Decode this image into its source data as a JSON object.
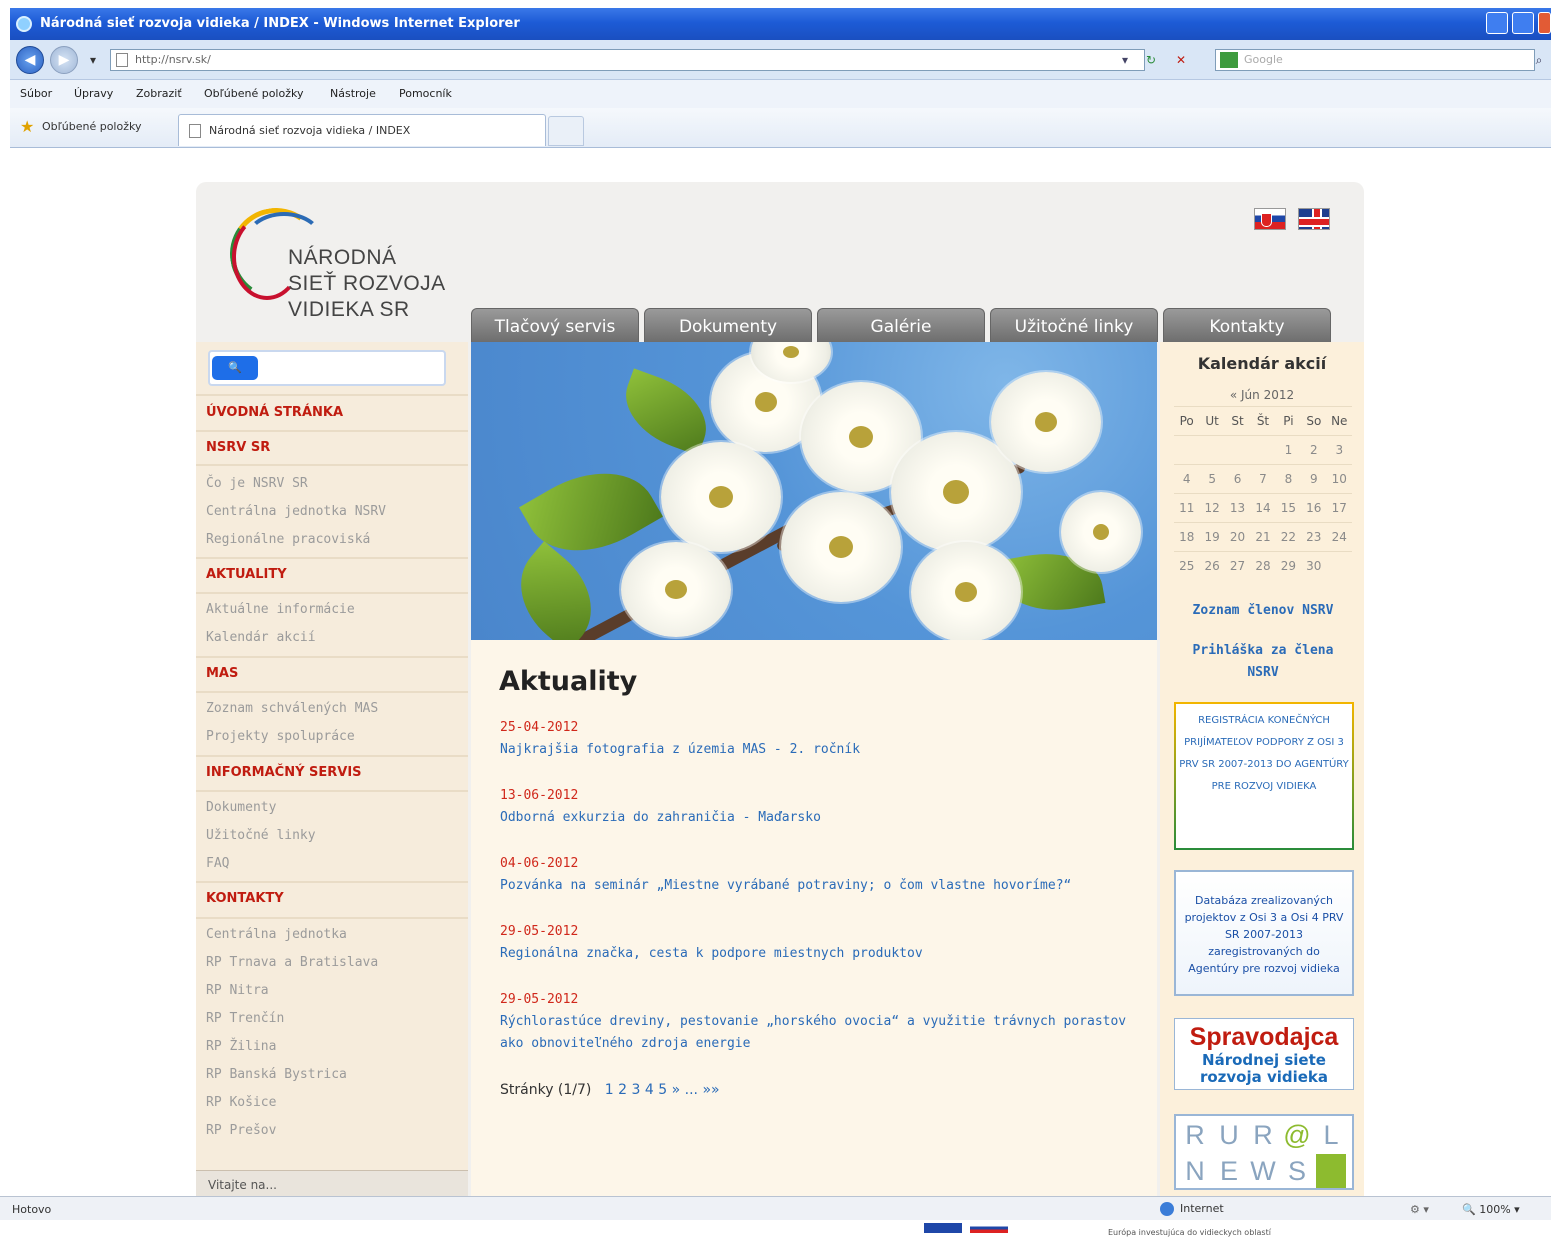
{
  "browser": {
    "window_title": "Národná sieť rozvoja vidieka / INDEX - Windows Internet Explorer",
    "url": "http://nsrv.sk/",
    "search_placeholder": "Google",
    "menu": [
      "Súbor",
      "Úpravy",
      "Zobraziť",
      "Obľúbené položky",
      "Nástroje",
      "Pomocník"
    ],
    "favorites_label": "Obľúbené položky",
    "tab_title": "Národná sieť rozvoja vidieka / INDEX",
    "status_left": "Hotovo",
    "status_zone": "Internet",
    "status_zoom": "100%"
  },
  "site": {
    "logo": {
      "line1": "NÁRODNÁ",
      "line2": "SIEŤ ROZVOJA",
      "line3": "VIDIEKA SR"
    },
    "nav_tabs": [
      "Tlačový servis",
      "Dokumenty",
      "Galérie",
      "Užitočné linky",
      "Kontakty"
    ],
    "sidebar": {
      "uvodna": "ÚVODNÁ STRÁNKA",
      "nsrv_head": "NSRV SR",
      "nsrv_items": [
        "Čo je NSRV SR",
        "Centrálna jednotka NSRV",
        "Regionálne pracoviská"
      ],
      "aktuality_head": "AKTUALITY",
      "aktuality_items": [
        "Aktuálne informácie",
        "Kalendár akcií"
      ],
      "mas_head": "MAS",
      "mas_items": [
        "Zoznam schválených MAS",
        "Projekty spolupráce"
      ],
      "info_head": "INFORMAČNÝ SERVIS",
      "info_items": [
        "Dokumenty",
        "Užitočné linky",
        "FAQ"
      ],
      "kontakty_head": "KONTAKTY",
      "kontakty_items": [
        "Centrálna jednotka",
        "RP Trnava a Bratislava",
        "RP Nitra",
        "RP Trenčín",
        "RP Žilina",
        "RP Banská Bystrica",
        "RP Košice",
        "RP Prešov"
      ],
      "bottom": "Vitajte na..."
    },
    "content": {
      "heading": "Aktuality",
      "news": [
        {
          "date": "25-04-2012",
          "title": "Najkrajšia fotografia z územia MAS - 2. ročník"
        },
        {
          "date": "13-06-2012",
          "title": "Odborná exkurzia do zahraničia - Maďarsko"
        },
        {
          "date": "04-06-2012",
          "title": "Pozvánka na seminár „Miestne vyrábané potraviny; o čom vlastne hovoríme?“"
        },
        {
          "date": "29-05-2012",
          "title": "Regionálna značka, cesta k podpore miestnych produktov"
        },
        {
          "date": "29-05-2012",
          "title": "Rýchlorastúce dreviny, pestovanie „horského ovocia“ a využitie trávnych porastov ako obnoviteľného zdroja energie"
        }
      ],
      "pager_label": "Stránky (1/7)",
      "pages": [
        "1",
        "2",
        "3",
        "4",
        "5",
        "»",
        "...",
        "»»"
      ]
    },
    "right": {
      "calendar_title": "Kalendár akcií",
      "month": "« Jún 2012",
      "weekdays": [
        "Po",
        "Ut",
        "St",
        "Št",
        "Pi",
        "So",
        "Ne"
      ],
      "weeks": [
        [
          "",
          "",
          "",
          "",
          "1",
          "2",
          "3"
        ],
        [
          "4",
          "5",
          "6",
          "7",
          "8",
          "9",
          "10"
        ],
        [
          "11",
          "12",
          "13",
          "14",
          "15",
          "16",
          "17"
        ],
        [
          "18",
          "19",
          "20",
          "21",
          "22",
          "23",
          "24"
        ],
        [
          "25",
          "26",
          "27",
          "28",
          "29",
          "30",
          ""
        ]
      ],
      "link1": "Zoznam členov NSRV",
      "link2": "Prihláška za člena NSRV",
      "banner_registration": "REGISTRÁCIA KONEČNÝCH PRIJÍMATEĽOV PODPORY Z OSI 3 PRV SR 2007-2013 DO AGENTÚRY PRE ROZVOJ VIDIEKA",
      "banner_database": "Databáza zrealizovaných projektov z Osi 3 a Osi 4 PRV SR 2007-2013 zaregistrovaných do Agentúry pre rozvoj vidieka",
      "banner_sprav_1": "Spravodajca",
      "banner_sprav_2": "Národnej siete",
      "banner_sprav_3": "rozvoja vidieka",
      "rural_row1": [
        "R",
        "U",
        "R",
        "@",
        "L"
      ],
      "rural_row2": [
        "N",
        "E",
        "W",
        "S",
        ""
      ]
    },
    "footer_text": "Európa investujúca do vidieckych oblastí"
  }
}
